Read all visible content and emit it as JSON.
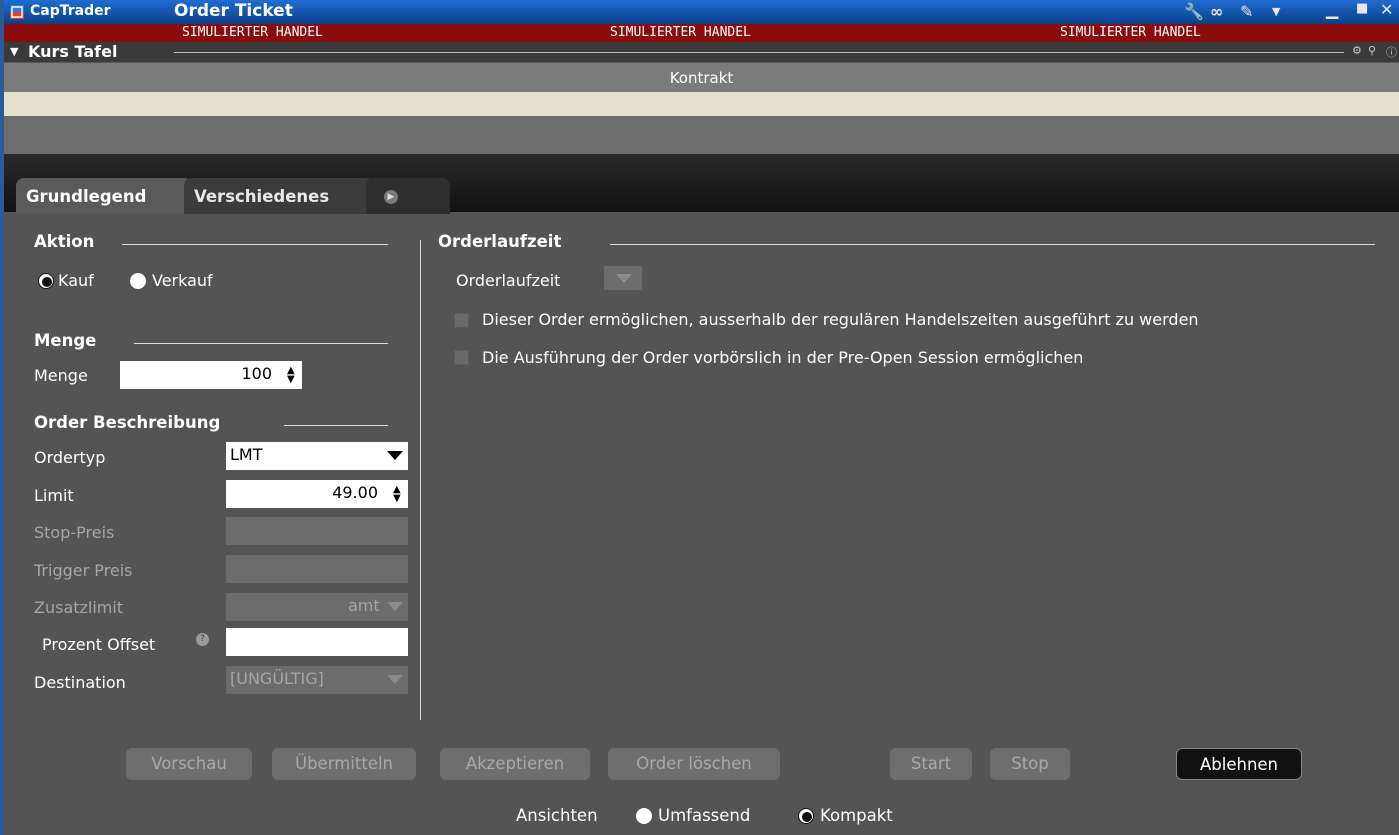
{
  "titlebar": {
    "app_name": "CapTrader",
    "window_title": "Order Ticket",
    "icons": [
      "wrench-icon",
      "link-icon",
      "pin-icon",
      "dropdown-icon",
      "minimize-icon",
      "maximize-icon",
      "close-icon"
    ]
  },
  "banner": {
    "text_left": "SIMULIERTER HANDEL",
    "text_mid": "SIMULIERTER HANDEL",
    "text_right": "SIMULIERTER HANDEL",
    "color": "#8a0c0c"
  },
  "quote_panel": {
    "title": "Kurs Tafel",
    "column_header": "Kontrakt"
  },
  "tabs": [
    {
      "label": "Grundlegend",
      "active": true
    },
    {
      "label": "Verschiedenes",
      "active": false
    }
  ],
  "action": {
    "title": "Aktion",
    "buy_label": "Kauf",
    "sell_label": "Verkauf",
    "selected": "Kauf"
  },
  "quantity": {
    "title": "Menge",
    "label": "Menge",
    "value": "100"
  },
  "order_desc": {
    "title": "Order Beschreibung",
    "order_type_label": "Ordertyp",
    "order_type_value": "LMT",
    "limit_label": "Limit",
    "limit_value": "49.00",
    "stop_label": "Stop-Preis",
    "trigger_label": "Trigger Preis",
    "aux_limit_label": "Zusatzlimit",
    "aux_limit_value": "amt",
    "percent_offset_label": "Prozent Offset",
    "destination_label": "Destination",
    "destination_value": "[UNGÜLTIG]"
  },
  "tif": {
    "title": "Orderlaufzeit",
    "label": "Orderlaufzeit",
    "checkbox_outside_rth": "Dieser Order ermöglichen, ausserhalb der regulären Handelszeiten ausgeführt zu werden",
    "checkbox_preopen": "Die Ausführung der Order vorbörslich in der Pre-Open Session ermöglichen"
  },
  "buttons": {
    "preview": "Vorschau",
    "transmit": "Übermitteln",
    "accept": "Akzeptieren",
    "delete": "Order löschen",
    "start": "Start",
    "stop": "Stop",
    "reject": "Ablehnen"
  },
  "views": {
    "label": "Ansichten",
    "full": "Umfassend",
    "compact": "Kompakt",
    "selected": "Kompakt"
  }
}
